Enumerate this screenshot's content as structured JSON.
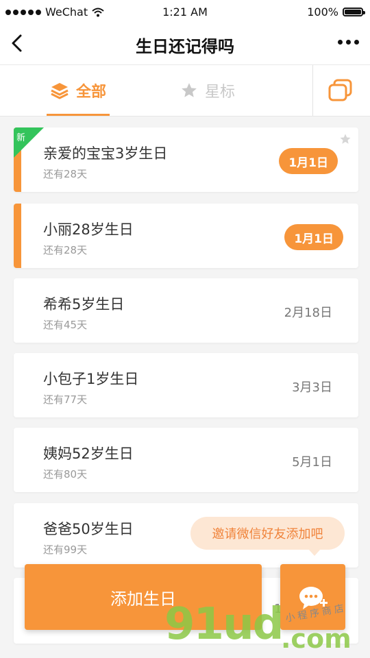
{
  "status_bar": {
    "carrier": "WeChat",
    "time": "1:21 AM",
    "battery": "100%"
  },
  "nav": {
    "title": "生日还记得吗"
  },
  "tabs": {
    "all_label": "全部",
    "starred_label": "星标"
  },
  "birthdays": [
    {
      "name": "亲爱的宝宝3岁生日",
      "days_left": "还有28天",
      "date": "1月1日",
      "badge": "新",
      "highlighted": true,
      "starred_icon": true
    },
    {
      "name": "小丽28岁生日",
      "days_left": "还有28天",
      "date": "1月1日",
      "highlighted": true
    },
    {
      "name": "希希5岁生日",
      "days_left": "还有45天",
      "date": "2月18日"
    },
    {
      "name": "小包子1岁生日",
      "days_left": "还有77天",
      "date": "3月3日"
    },
    {
      "name": "姨妈52岁生日",
      "days_left": "还有80天",
      "date": "5月1日"
    },
    {
      "name": "爸爸50岁生日",
      "days_left": "还有99天",
      "date": ""
    }
  ],
  "invite_tip": "邀请微信好友添加吧",
  "add_button_label": "添加生日",
  "partial_card_text": "1",
  "watermark": {
    "logo": "91ud",
    "domain": ".com",
    "tagline": "小程序商店"
  },
  "colors": {
    "accent": "#f7953a",
    "new_badge": "#33c45b",
    "tip_bg": "#fde7d4"
  }
}
